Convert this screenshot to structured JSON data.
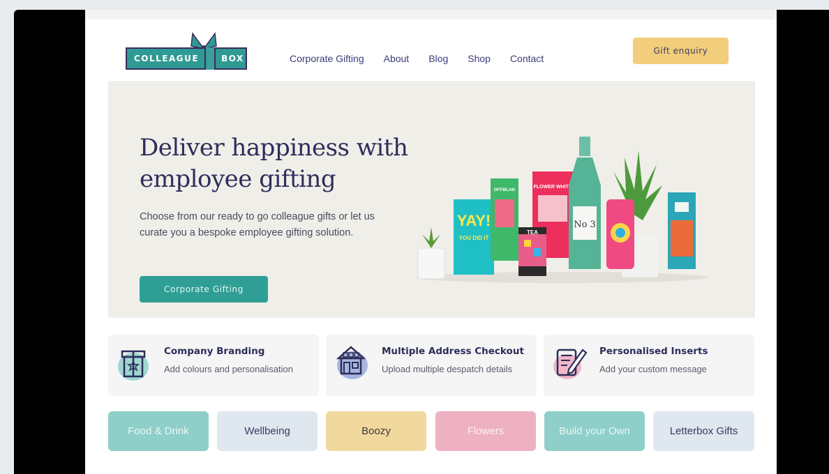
{
  "brand": {
    "logo_word1": "COLLEAGUE",
    "logo_word2": "BOX",
    "colors": {
      "teal": "#2f9f95",
      "navy": "#2c2e5a",
      "yellow": "#f1cd7c",
      "cream": "#f0eee9"
    }
  },
  "nav": {
    "items": [
      {
        "label": "Corporate Gifting"
      },
      {
        "label": "About"
      },
      {
        "label": "Blog"
      },
      {
        "label": "Shop"
      },
      {
        "label": "Contact"
      }
    ],
    "cta_label": "Gift enquiry"
  },
  "hero": {
    "title": "Deliver happiness with employee gifting",
    "body": "Choose from our ready to go colleague gifts or let us curate you a bespoke employee gifting solution.",
    "cta_label": "Corporate Gifting",
    "art_labels": {
      "card": "YAY!",
      "card_sub": "YOU DID IT",
      "choc": "OFFBLAK",
      "flower": "FLOWER WHITE",
      "bottle": "No 3",
      "tea": "TEA"
    }
  },
  "features": [
    {
      "title": "Company Branding",
      "subtitle": "Add colours and personalisation",
      "icon": "gift-box-icon"
    },
    {
      "title": "Multiple Address Checkout",
      "subtitle": "Upload multiple despatch details",
      "icon": "houses-icon"
    },
    {
      "title": "Personalised Inserts",
      "subtitle": "Add your custom message",
      "icon": "pen-paper-icon"
    }
  ],
  "categories": [
    {
      "label": "Food & Drink",
      "bg": "#8fcfc9",
      "fg": "#e9f6f4"
    },
    {
      "label": "Wellbeing",
      "bg": "#dfe7ef",
      "fg": "#3a3a5e"
    },
    {
      "label": "Boozy",
      "bg": "#f1d89e",
      "fg": "#3a3a3a"
    },
    {
      "label": "Flowers",
      "bg": "#eeb1c1",
      "fg": "#fbeef2"
    },
    {
      "label": "Build your Own",
      "bg": "#8fcfc9",
      "fg": "#e9f6f4"
    },
    {
      "label": "Letterbox Gifts",
      "bg": "#dfe7ef",
      "fg": "#3a3a5e"
    }
  ]
}
